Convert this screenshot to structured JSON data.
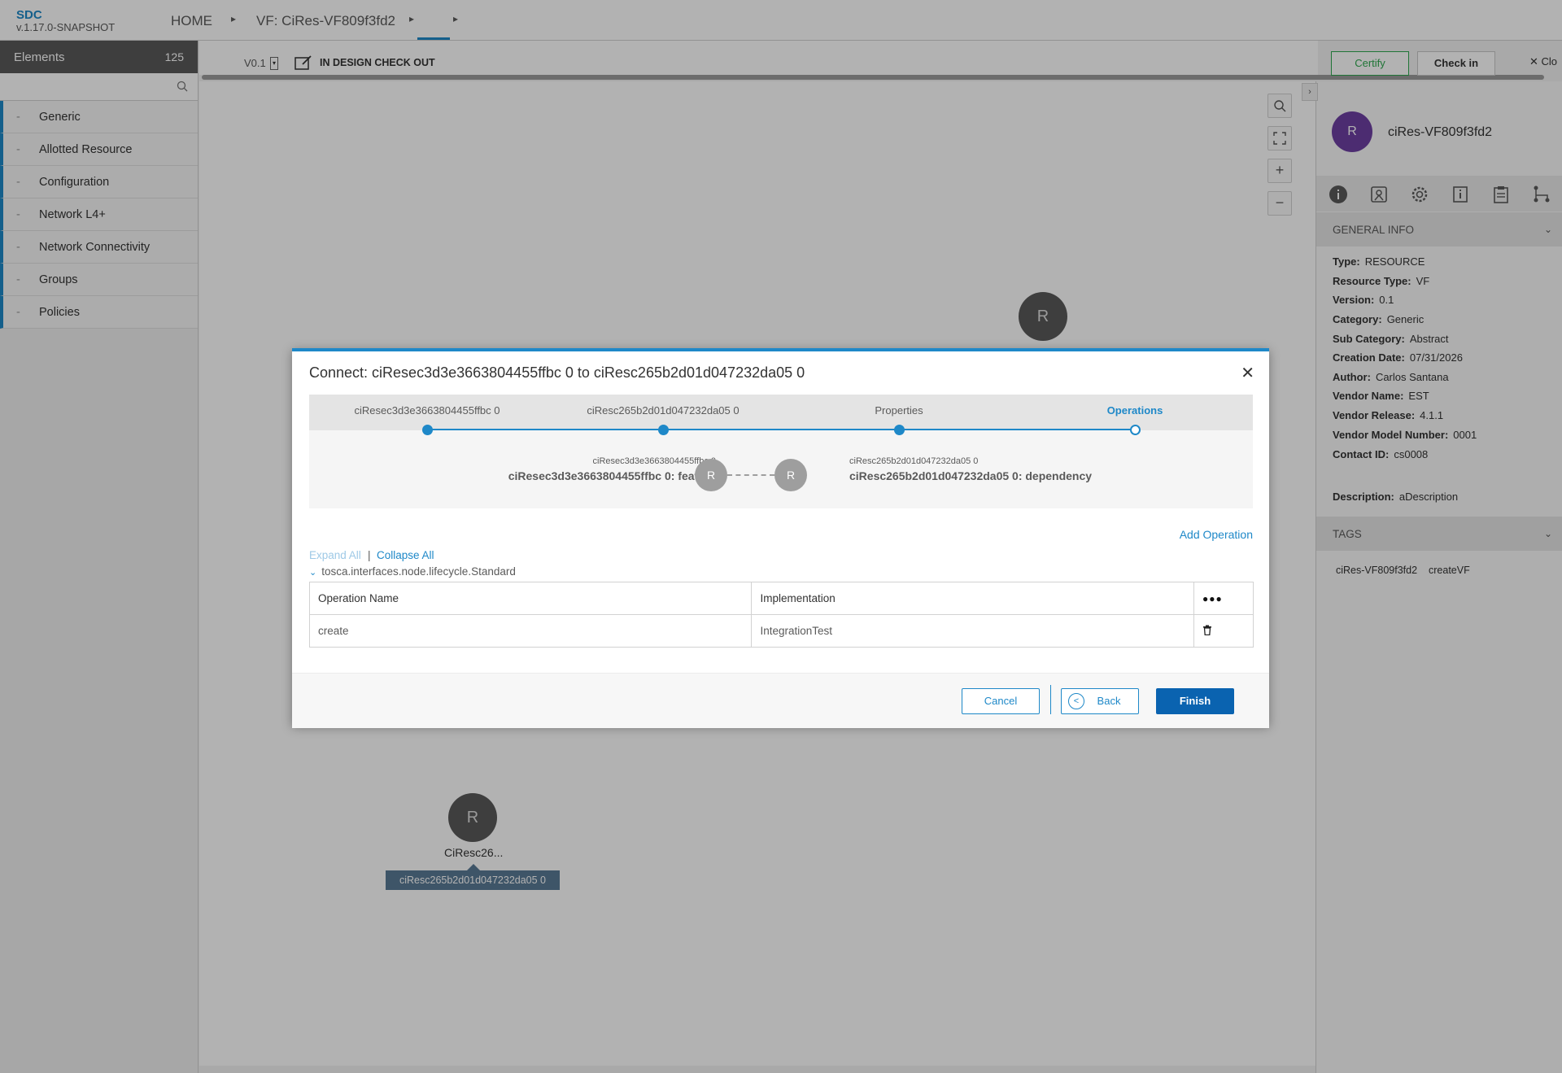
{
  "app": {
    "title": "SDC",
    "version": "v.1.17.0-SNAPSHOT"
  },
  "breadcrumb": {
    "home": "HOME",
    "current": "VF: CiRes-VF809f3fd2"
  },
  "palette": {
    "header": "Elements",
    "count": "125",
    "search_placeholder": "",
    "items": [
      {
        "label": "Generic"
      },
      {
        "label": "Allotted Resource"
      },
      {
        "label": "Configuration"
      },
      {
        "label": "Network L4+"
      },
      {
        "label": "Network Connectivity"
      },
      {
        "label": "Groups"
      },
      {
        "label": "Policies"
      }
    ]
  },
  "toolbar": {
    "version": "V0.1",
    "status": "IN DESIGN CHECK OUT",
    "certify": "Certify",
    "checkin": "Check in",
    "close": "Clo"
  },
  "canvas": {
    "node_top_letter": "R",
    "node_bottom_letter": "R",
    "node_bottom_label": "CiResc26...",
    "node_bottom_tooltip": "ciResc265b2d01d047232da05 0",
    "tools": [
      "search-icon",
      "fit-icon",
      "zoom-in-icon",
      "zoom-out-icon"
    ]
  },
  "right_panel": {
    "avatar_letter": "R",
    "name": "ciRes-VF809f3fd2",
    "general_info_title": "GENERAL INFO",
    "fields": [
      {
        "label": "Type:",
        "value": "RESOURCE"
      },
      {
        "label": "Resource Type:",
        "value": "VF"
      },
      {
        "label": "Version:",
        "value": "0.1"
      },
      {
        "label": "Category:",
        "value": "Generic"
      },
      {
        "label": "Sub Category:",
        "value": "Abstract"
      },
      {
        "label": "Creation Date:",
        "value": "07/31/2026"
      },
      {
        "label": "Author:",
        "value": "Carlos Santana"
      },
      {
        "label": "Vendor Name:",
        "value": "EST"
      },
      {
        "label": "Vendor Release:",
        "value": "4.1.1"
      },
      {
        "label": "Vendor Model Number:",
        "value": "0001"
      },
      {
        "label": "Contact ID:",
        "value": "cs0008"
      }
    ],
    "description_label": "Description:",
    "description_value": "aDescription",
    "tags_title": "TAGS",
    "tags": [
      "ciRes-VF809f3fd2",
      "createVF"
    ]
  },
  "modal": {
    "title": "Connect: ciResec3d3e3663804455ffbc 0 to ciResc265b2d01d047232da05 0",
    "steps": [
      {
        "label": "ciResec3d3e3663804455ffbc 0"
      },
      {
        "label": "ciResc265b2d01d047232da05 0"
      },
      {
        "label": "Properties"
      },
      {
        "label": "Operations"
      }
    ],
    "from_small": "ciResec3d3e3663804455ffbc 0",
    "from_big": "ciResec3d3e3663804455ffbc 0: feature",
    "to_small": "ciResc265b2d01d047232da05 0",
    "to_big": "ciResc265b2d01d047232da05 0: dependency",
    "node_letter": "R",
    "add_operation": "Add Operation",
    "expand_all": "Expand All",
    "separator": "|",
    "collapse_all": "Collapse All",
    "interface_name": "tosca.interfaces.node.lifecycle.Standard",
    "table": {
      "headers": [
        "Operation Name",
        "Implementation",
        "●●●"
      ],
      "rows": [
        {
          "name": "create",
          "implementation": "IntegrationTest"
        }
      ]
    },
    "buttons": {
      "cancel": "Cancel",
      "back": "Back",
      "finish": "Finish"
    }
  }
}
